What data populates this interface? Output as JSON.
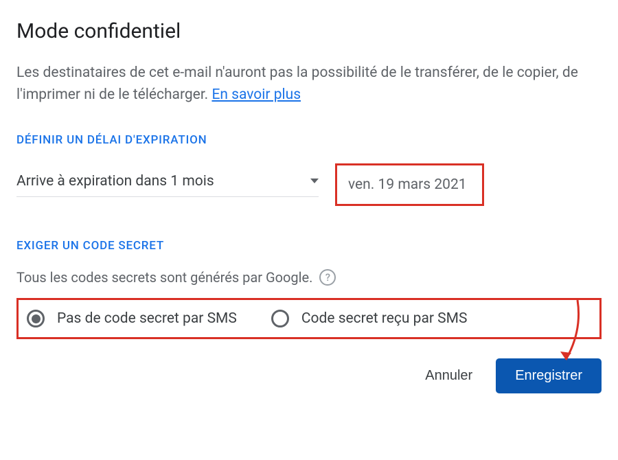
{
  "dialog": {
    "title": "Mode confidentiel",
    "description_text": "Les destinataires de cet e-mail n'auront pas la possibilité de le transférer, de le copier, de l'imprimer ni de le télécharger. ",
    "learn_more": "En savoir plus"
  },
  "expiration": {
    "section_label": "DÉFINIR UN DÉLAI D'EXPIRATION",
    "dropdown_value": "Arrive à expiration dans 1 mois",
    "date_display": "ven. 19 mars 2021"
  },
  "passcode": {
    "section_label": "EXIGER UN CODE SECRET",
    "subtext": "Tous les codes secrets sont générés par Google.",
    "options": [
      {
        "label": "Pas de code secret par SMS",
        "selected": true
      },
      {
        "label": "Code secret reçu par SMS",
        "selected": false
      }
    ]
  },
  "buttons": {
    "cancel": "Annuler",
    "save": "Enregistrer"
  }
}
